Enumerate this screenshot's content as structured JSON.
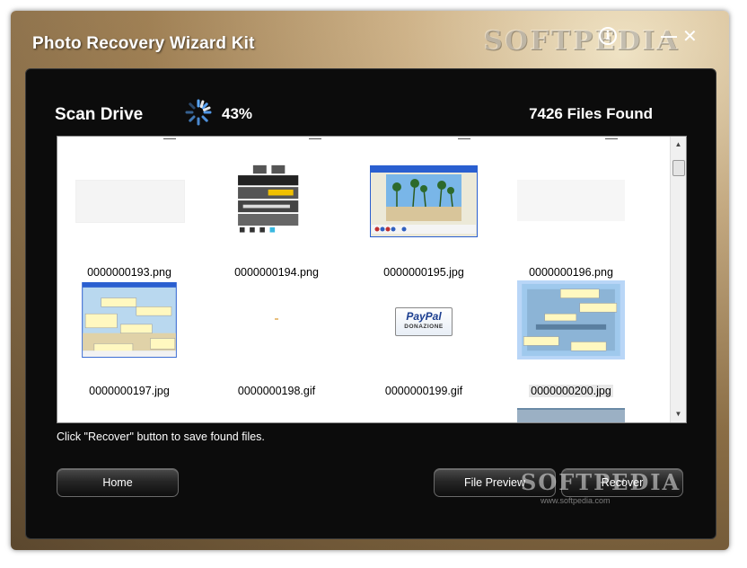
{
  "window": {
    "title": "Photo Recovery Wizard Kit",
    "watermark": "SOFTPEDIA",
    "info_glyph": "i",
    "minimize_glyph": "—",
    "close_glyph": "✕"
  },
  "scan": {
    "label": "Scan Drive",
    "progress_percent": "43%",
    "files_found": "7426 Files Found"
  },
  "files": [
    {
      "name": "0000000193.png",
      "thumb": "blank-image"
    },
    {
      "name": "0000000194.png",
      "thumb": "web-ui-screenshot"
    },
    {
      "name": "0000000195.jpg",
      "thumb": "beach-palm-trees-window"
    },
    {
      "name": "0000000196.png",
      "thumb": "blank-image"
    },
    {
      "name": "0000000197.jpg",
      "thumb": "annotated-screenshot"
    },
    {
      "name": "0000000198.gif",
      "thumb": "tiny-image"
    },
    {
      "name": "0000000199.gif",
      "thumb": "paypal-donazione"
    },
    {
      "name": "0000000200.jpg",
      "thumb": "annotated-screenshot-selected",
      "selected": true
    }
  ],
  "paypal": {
    "brand": "PayPal",
    "sub": "DONAZIONE"
  },
  "status_text": "Click \"Recover\" button to save found files.",
  "buttons": {
    "home": "Home",
    "file_preview": "File Preview",
    "recover": "Recover"
  },
  "bottom_watermark": {
    "text": "SOFTPEDIA",
    "url": "www.softpedia.com"
  },
  "colors": {
    "panel": "#0c0c0c",
    "accent_spinner": "#5aa8ff",
    "selection": "#b9d6f7"
  }
}
